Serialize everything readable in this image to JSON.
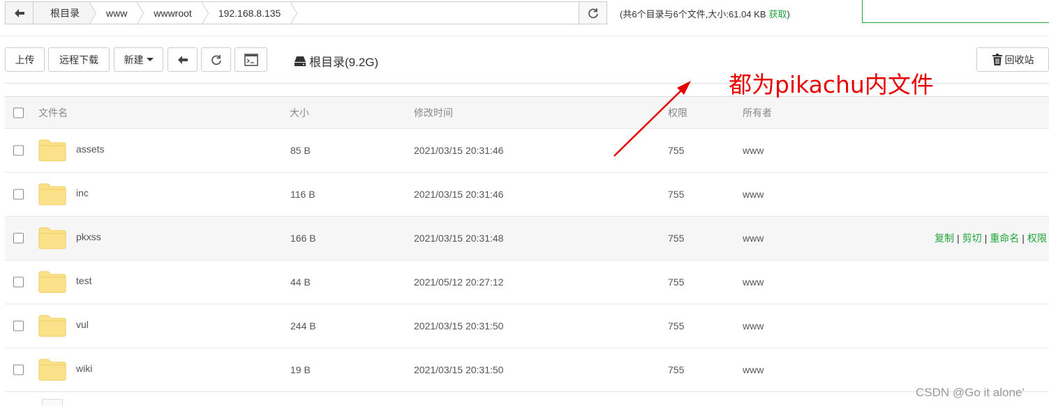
{
  "path_bar": {
    "crumbs": [
      "根目录",
      "www",
      "wwwroot",
      "192.168.8.135"
    ]
  },
  "summary": {
    "text": "(共6个目录与6个文件,大小:61.04 KB",
    "fetch_label": "获取",
    "close": ")"
  },
  "toolbar": {
    "upload": "上传",
    "remote_download": "远程下载",
    "new": "新建",
    "disk_label": "根目录(9.2G)",
    "recycle": "回收站"
  },
  "table": {
    "headers": [
      "文件名",
      "大小",
      "修改时间",
      "权限",
      "所有者"
    ],
    "rows": [
      {
        "name": "assets",
        "size": "85 B",
        "mtime": "2021/03/15 20:31:46",
        "perm": "755",
        "owner": "www"
      },
      {
        "name": "inc",
        "size": "116 B",
        "mtime": "2021/03/15 20:31:46",
        "perm": "755",
        "owner": "www"
      },
      {
        "name": "pkxss",
        "size": "166 B",
        "mtime": "2021/03/15 20:31:48",
        "perm": "755",
        "owner": "www"
      },
      {
        "name": "test",
        "size": "44 B",
        "mtime": "2021/05/12 20:27:12",
        "perm": "755",
        "owner": "www"
      },
      {
        "name": "vul",
        "size": "244 B",
        "mtime": "2021/03/15 20:31:50",
        "perm": "755",
        "owner": "www"
      },
      {
        "name": "wiki",
        "size": "19 B",
        "mtime": "2021/03/15 20:31:50",
        "perm": "755",
        "owner": "www"
      }
    ],
    "row_ops": {
      "copy": "复制",
      "cut": "剪切",
      "rename": "重命名",
      "perm": "权限"
    }
  },
  "annotation": "都为pikachu内文件",
  "watermark": "CSDN @Go it alone'",
  "colors": {
    "accent": "#20a53a",
    "folder": "#fbe18a",
    "annotation": "#e60000"
  }
}
